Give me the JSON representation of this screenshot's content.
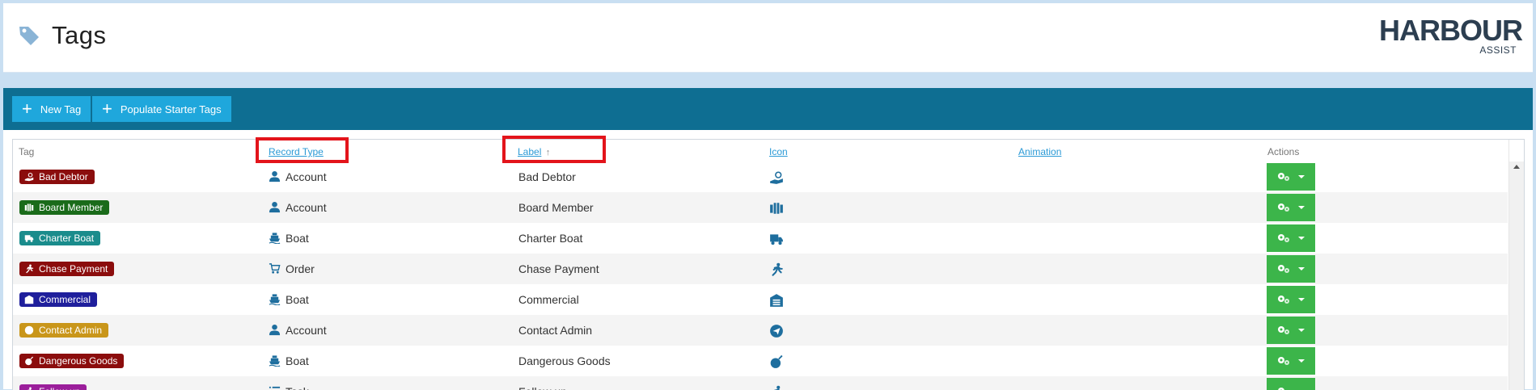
{
  "header": {
    "title": "Tags",
    "logo": {
      "main": "HARBOUR",
      "sub": "ASSIST"
    }
  },
  "toolbar": {
    "new_tag_label": "New Tag",
    "populate_label": "Populate Starter Tags"
  },
  "table": {
    "columns": {
      "tag": "Tag",
      "record_type": "Record Type",
      "label": "Label",
      "label_sort_indicator": "↑",
      "icon": "Icon",
      "animation": "Animation",
      "actions": "Actions"
    },
    "rows": [
      {
        "tag": "Bad Debtor",
        "color": "#8b0d0d",
        "icon": "hand-holding-dollar-icon",
        "record_type": "Account",
        "record_icon": "person-icon",
        "label": "Bad Debtor"
      },
      {
        "tag": "Board Member",
        "color": "#1a6b1a",
        "icon": "people-group-icon",
        "record_type": "Account",
        "record_icon": "person-icon",
        "label": "Board Member"
      },
      {
        "tag": "Charter Boat",
        "color": "#1a8c8c",
        "icon": "truck-ramp-icon",
        "record_type": "Boat",
        "record_icon": "boat-icon",
        "label": "Charter Boat"
      },
      {
        "tag": "Chase Payment",
        "color": "#8b0d0d",
        "icon": "running-person-icon",
        "record_type": "Order",
        "record_icon": "cart-icon",
        "label": "Chase Payment"
      },
      {
        "tag": "Commercial",
        "color": "#1f1f9c",
        "icon": "warehouse-icon",
        "record_type": "Boat",
        "record_icon": "boat-icon",
        "label": "Commercial"
      },
      {
        "tag": "Contact Admin",
        "color": "#c9961a",
        "icon": "paper-plane-icon",
        "record_type": "Account",
        "record_icon": "person-icon",
        "label": "Contact Admin"
      },
      {
        "tag": "Dangerous Goods",
        "color": "#8b0d0d",
        "icon": "bomb-icon",
        "record_type": "Boat",
        "record_icon": "boat-icon",
        "label": "Dangerous Goods"
      },
      {
        "tag": "Follow up",
        "color": "#9b1f9b",
        "icon": "running-person-icon",
        "record_type": "Task",
        "record_icon": "list-icon",
        "label": "Follow up"
      }
    ]
  },
  "colors": {
    "toolbar_bg": "#0e6e92",
    "button_bg": "#1fa7dc",
    "action_green": "#3cb54a",
    "link_blue": "#2b9ad6",
    "icon_color": "#1e6e9e",
    "highlight_red": "#e3141b"
  }
}
